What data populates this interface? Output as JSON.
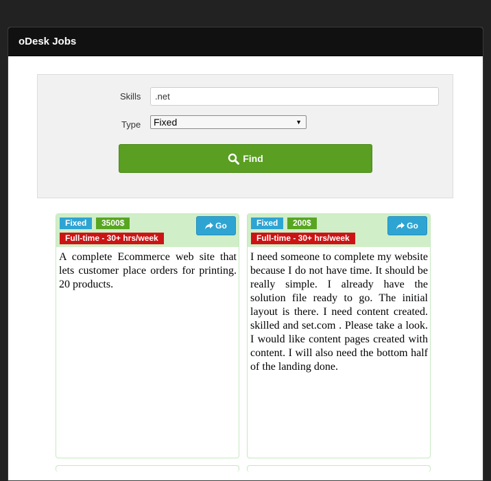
{
  "window": {
    "title": "oDesk Jobs"
  },
  "search": {
    "skills_label": "Skills",
    "skills_value": ".net",
    "type_label": "Type",
    "type_value": "Fixed",
    "find_label": "Find"
  },
  "jobs": [
    {
      "type": "Fixed",
      "budget": "3500$",
      "workload": "Full-time - 30+ hrs/week",
      "go_label": "Go",
      "description": "A complete Ecommerce web site that lets customer place orders for printing. 20 products."
    },
    {
      "type": "Fixed",
      "budget": "200$",
      "workload": "Full-time - 30+ hrs/week",
      "go_label": "Go",
      "description": "I need someone to complete my website because I do not have time. It should be really simple. I already have the solution file ready to go. The initial layout is there. I need content created. skilled and set.com . Please take a look. I would like content pages created with content. I will also need the bottom half of the landing done."
    }
  ],
  "colors": {
    "header_bg": "#111111",
    "find_button": "#5a9e22",
    "type_badge": "#2ea4d3",
    "budget_badge": "#58a522",
    "workload_badge": "#cc1414",
    "card_header": "#d0eec8"
  }
}
